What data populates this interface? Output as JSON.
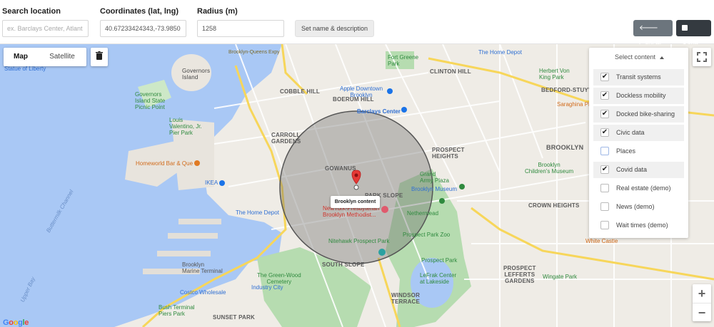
{
  "form": {
    "search_label": "Search location",
    "search_placeholder": "ex. Barclays Center, Atlant",
    "coords_label": "Coordinates (lat, lng)",
    "coords_value": "40.67233424343,-73.9850",
    "radius_label": "Radius (m)",
    "radius_value": "1258",
    "name_desc_button": "Set name & description",
    "cancel_button": "Cancel",
    "save_button": "Save"
  },
  "map_controls": {
    "map_label": "Map",
    "satellite_label": "Satellite",
    "zoom_in": "+",
    "zoom_out": "−"
  },
  "content_menu": {
    "title": "Select content",
    "items": [
      {
        "label": "Transit systems",
        "checked": true
      },
      {
        "label": "Dockless mobility",
        "checked": true
      },
      {
        "label": "Docked bike-sharing",
        "checked": true
      },
      {
        "label": "Civic data",
        "checked": true
      },
      {
        "label": "Places",
        "checked": false
      },
      {
        "label": "Covid data",
        "checked": true
      },
      {
        "label": "Real estate (demo)",
        "checked": false
      },
      {
        "label": "News (demo)",
        "checked": false
      },
      {
        "label": "Wait times (demo)",
        "checked": false
      }
    ]
  },
  "marker_popup": "Brooklyn content",
  "map_labels": {
    "statue_of_liberty": "Statue of Liberty",
    "governors_island": "Governors\nIsland",
    "governors_island_park": "Governors\nIsland State\nPicnic Point",
    "valentino_pier": "Louis\nValentino, Jr.\nPier Park",
    "homeworld": "Homeworld Bar & Que",
    "ikea": "IKEA",
    "home_depot_1": "The Home Depot",
    "home_depot_2": "The Home Depot",
    "cobble_hill": "COBBLE HILL",
    "carroll_gardens": "CARROLL\nGARDENS",
    "boerum_hill": "BOERUM HILL",
    "gowanus": "GOWANUS",
    "park_slope": "PARK SLOPE",
    "south_slope": "SOUTH SLOPE",
    "prospect_heights": "PROSPECT\nHEIGHTS",
    "clinton_hill": "CLINTON HILL",
    "brooklyn": "BROOKLYN",
    "crown_heights": "CROWN HEIGHTS",
    "bedford_stuyvesant": "BEDFORD-STUYVESANT",
    "prospect_lefferts": "PROSPECT\nLEFFERTS\nGARDENS",
    "windsor_terrace": "WINDSOR\nTERRACE",
    "sunset_park": "SUNSET PARK",
    "barclays": "Barclays Center",
    "apple_downtown": "Apple Downtown\nBrooklyn",
    "fort_greene": "Fort Greene\nPark",
    "prospect_park_zoo": "Prospect Park Zoo",
    "prospect_park": "Prospect Park",
    "nethermead": "Nethermead",
    "brooklyn_museum": "Brooklyn Museum",
    "childrens_museum": "Brooklyn\nChildren's Museum",
    "grand_army_plaza": "Grand\nArmy Plaza",
    "brooklyn_methodist": "NewYork-Presbyterian\nBrooklyn Methodist...",
    "nitehawk": "Nitehawk Prospect Park",
    "green_wood": "The Green-Wood\nCemetery",
    "industry_city": "Industry City",
    "costco": "Costco Wholesale",
    "bush_terminal": "Bush Terminal\nPiers Park",
    "brooklyn_marine": "Brooklyn\nMarine Terminal",
    "lefrak": "LeFrak Center\nat Lakeside",
    "wingate": "Wingate Park",
    "white_castle": "White Castle",
    "saraghina": "Saraghina Pizza",
    "king_park": "Herbert Von\nKing Park",
    "upper_bay": "Upper Bay",
    "buttermilk": "Buttermilk Channel",
    "brooklyn_expy": "Brooklyn-Queens Expy"
  }
}
